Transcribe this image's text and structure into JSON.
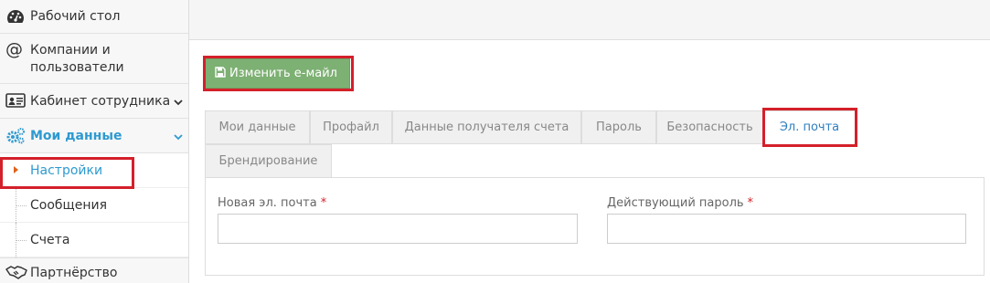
{
  "sidebar": {
    "items": [
      {
        "label": "Рабочий стол",
        "icon": "dashboard-icon"
      },
      {
        "label": "Компании и пользователи",
        "line1": "Компании и",
        "line2": "пользователи",
        "icon": "at-icon"
      },
      {
        "label": "Кабинет сотрудника",
        "icon": "id-card-icon"
      },
      {
        "label": "Мои данные",
        "icon": "gears-icon"
      },
      {
        "label": "Партнёрство",
        "icon": "handshake-icon"
      }
    ],
    "subitems": [
      {
        "label": "Настройки"
      },
      {
        "label": "Сообщения"
      },
      {
        "label": "Счета"
      }
    ]
  },
  "toolbar": {
    "save_label": "Изменить е-майл"
  },
  "tabs": [
    {
      "label": "Мои данные"
    },
    {
      "label": "Профайл"
    },
    {
      "label": "Данные получателя счета"
    },
    {
      "label": "Пароль"
    },
    {
      "label": "Безопасность"
    },
    {
      "label": "Эл. почта"
    },
    {
      "label": "Брендирование"
    }
  ],
  "form": {
    "email_label": "Новая эл. почта",
    "email_value": "",
    "password_label": "Действующий пароль",
    "password_value": "",
    "required_mark": "*"
  },
  "colors": {
    "accent": "#2e9ad0",
    "save_button": "#7db073",
    "highlight": "#d4202a"
  }
}
